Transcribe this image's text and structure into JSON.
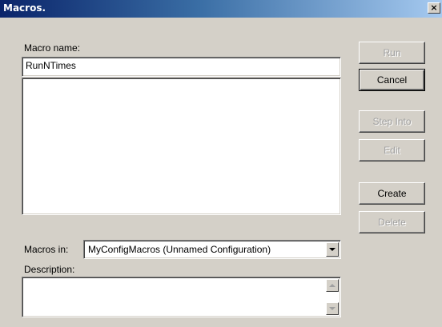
{
  "window": {
    "title": "Macros.",
    "close_glyph": "×"
  },
  "macro_name": {
    "label": "Macro name:",
    "value": "RunNTimes"
  },
  "macro_list": {
    "items": []
  },
  "macros_in": {
    "label": "Macros in:",
    "selected": "MyConfigMacros (Unnamed Configuration)"
  },
  "description": {
    "label": "Description:",
    "value": ""
  },
  "buttons": {
    "run": "Run",
    "cancel": "Cancel",
    "step_into": "Step Into",
    "edit": "Edit",
    "create": "Create",
    "delete": "Delete"
  },
  "colors": {
    "face": "#d4d0c8",
    "title_start": "#0a246a",
    "title_end": "#a6caf0",
    "disabled_text": "#a0a0a0"
  },
  "icons": {
    "close": "close-icon",
    "dropdown": "chevron-down-icon",
    "scroll_up": "scroll-up-icon",
    "scroll_down": "scroll-down-icon"
  }
}
